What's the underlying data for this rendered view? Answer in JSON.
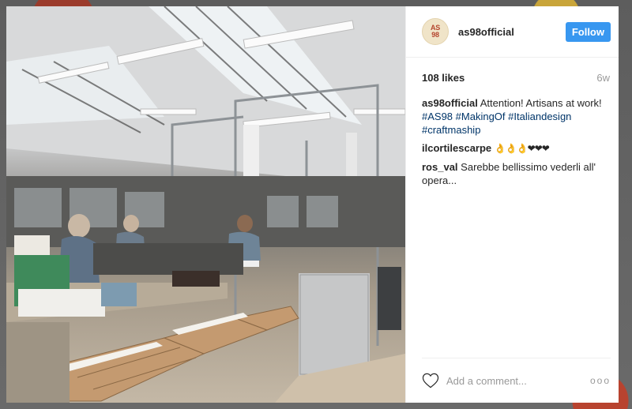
{
  "post": {
    "username": "as98official",
    "avatar_text_top": "AS",
    "avatar_text_bottom": "98",
    "follow_label": "Follow",
    "likes": "108 likes",
    "age": "6w"
  },
  "comments": [
    {
      "user": "as98official",
      "text": "Attention! Artisans at work!",
      "hashtags": [
        "#AS98",
        "#MakingOf",
        "#Italiandesign",
        "#craftmaship"
      ]
    },
    {
      "user": "ilcortilescarpe",
      "text": "👌👌👌❤❤❤"
    },
    {
      "user": "ros_val",
      "text": "Sarebbe bellissimo vederli all' opera..."
    }
  ],
  "footer": {
    "add_comment_placeholder": "Add a comment...",
    "more_label": "ooo",
    "heart_icon": "heart-icon"
  },
  "colors": {
    "accent": "#3897f0",
    "hashtag": "#003569",
    "text": "#262626",
    "muted": "#999999"
  }
}
